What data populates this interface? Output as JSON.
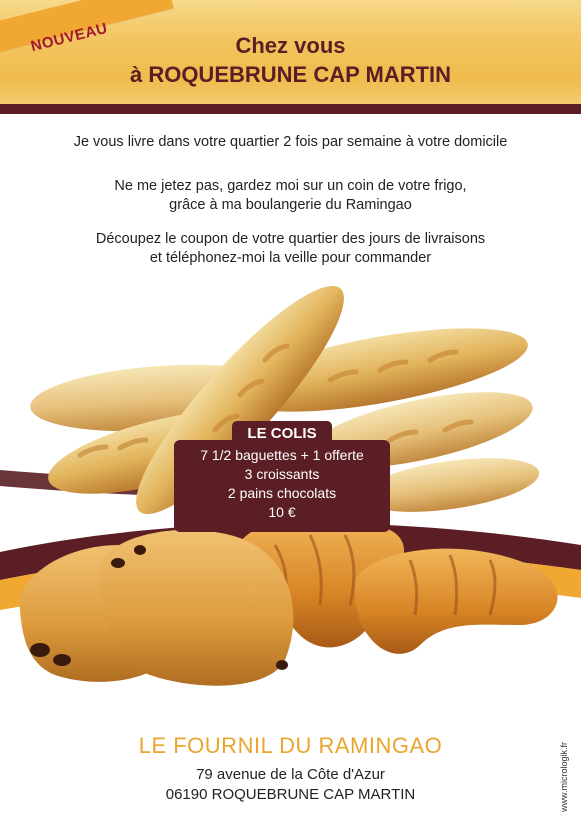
{
  "badge": "NOUVEAU",
  "header": {
    "line1": "Chez vous",
    "line2": "à ROQUEBRUNE CAP MARTIN"
  },
  "intro": {
    "p1": "Je vous livre dans votre quartier 2 fois par semaine à votre domicile",
    "p2a": "Ne me jetez pas, gardez moi sur un coin de votre frigo,",
    "p2b": "grâce à ma boulangerie du Ramingao",
    "p3a": "Découpez le coupon de votre quartier des jours de livraisons",
    "p3b": "et téléphonez-moi la veille pour commander"
  },
  "colis": {
    "title": "LE COLIS",
    "items": [
      "7 1/2 baguettes + 1 offerte",
      "3 croissants",
      "2 pains chocolats",
      "10 €"
    ]
  },
  "footer": {
    "brand": "LE FOURNIL DU RAMINGAO",
    "address1": "79 avenue de la Côte d'Azur",
    "address2": "06190 ROQUEBRUNE CAP MARTIN"
  },
  "credit": "www.micrologik.fr",
  "colors": {
    "maroon": "#5a1e24",
    "gold": "#f0bb4d",
    "orange_ribbon": "#f0a832",
    "brand_text": "#eaa52d"
  }
}
